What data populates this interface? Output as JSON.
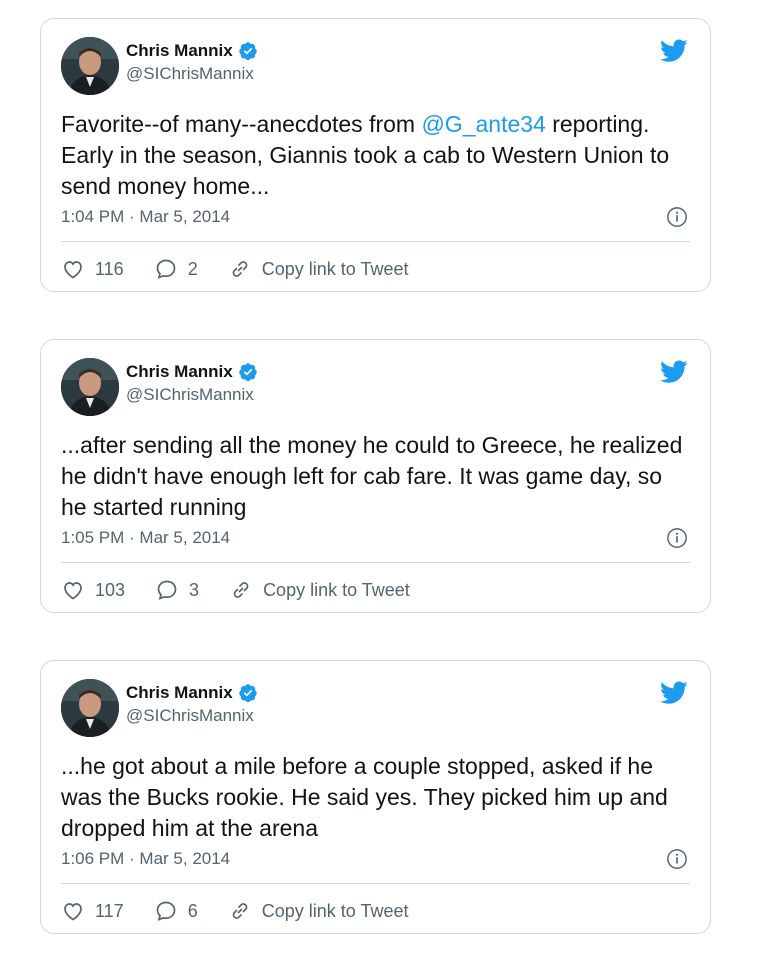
{
  "colors": {
    "accent": "#1d9bf0",
    "text": "#0f1419",
    "muted": "#536471",
    "border": "#cfd9de"
  },
  "tweets": [
    {
      "author_name": "Chris Mannix",
      "handle": "@SIChrisMannix",
      "text_mention": "@G_ante34",
      "text_before": "Favorite--of many--anecdotes from ",
      "text_after": " reporting. Early in the season, Giannis took a cab to Western Union to send money home...",
      "timestamp": "1:04 PM · Mar 5, 2014",
      "likes": "116",
      "replies": "2",
      "copy_link_label": "Copy link to Tweet",
      "icons": [
        "verified-badge-icon",
        "twitter-bird-icon",
        "info-icon",
        "heart-icon",
        "reply-icon",
        "link-icon"
      ]
    },
    {
      "author_name": "Chris Mannix",
      "handle": "@SIChrisMannix",
      "text": "...after sending all the money he could to Greece, he realized he didn't have enough left for cab fare. It was game day, so he started running",
      "timestamp": "1:05 PM · Mar 5, 2014",
      "likes": "103",
      "replies": "3",
      "copy_link_label": "Copy link to Tweet"
    },
    {
      "author_name": "Chris Mannix",
      "handle": "@SIChrisMannix",
      "text": "...he got about a mile before a couple stopped, asked if he was the Bucks rookie. He said yes. They picked him up and dropped him at the arena",
      "timestamp": "1:06 PM · Mar 5, 2014",
      "likes": "117",
      "replies": "6",
      "copy_link_label": "Copy link to Tweet"
    }
  ]
}
